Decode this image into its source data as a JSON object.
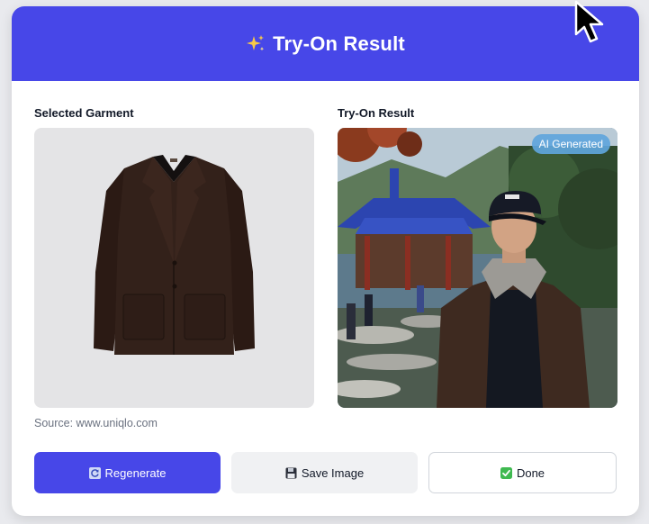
{
  "header": {
    "title": "Try-On Result",
    "icon": "sparkles-icon"
  },
  "garment": {
    "label": "Selected Garment",
    "source": "Source: www.uniqlo.com",
    "image": "dark-brown-blazer"
  },
  "result": {
    "label": "Try-On Result",
    "badge": "AI Generated",
    "image": "person-wearing-blazer-in-front-of-pavilion"
  },
  "buttons": {
    "regenerate": "Regenerate",
    "save": "Save Image",
    "done": "Done"
  },
  "colors": {
    "accent": "#4747e8",
    "badge": "#60a5dc",
    "background": "#e9eaee"
  }
}
